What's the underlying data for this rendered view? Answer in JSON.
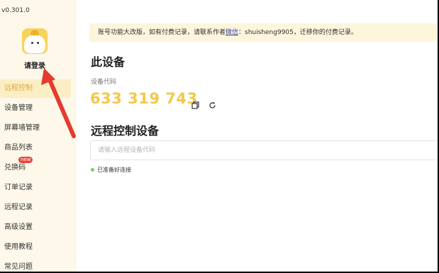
{
  "app": {
    "version": "v0.301.0"
  },
  "sidebar": {
    "login_label": "请登录",
    "items": [
      {
        "label": "远程控制",
        "active": true
      },
      {
        "label": "设备管理"
      },
      {
        "label": "屏幕墙管理"
      },
      {
        "label": "商品列表"
      },
      {
        "label": "兑换码",
        "badge": "new"
      },
      {
        "label": "订单记录"
      },
      {
        "label": "远程记录"
      },
      {
        "label": "高级设置"
      },
      {
        "label": "使用教程"
      },
      {
        "label": "常见问题"
      }
    ]
  },
  "notice": {
    "prefix": "账号功能大改版，如有付费记录，请联系作者",
    "link": "微信",
    "suffix": "：shuisheng9905，迁移你的付费记录。"
  },
  "device": {
    "heading": "此设备",
    "code_label": "设备代码",
    "code": "633 319 743"
  },
  "remote": {
    "heading": "远程控制设备",
    "input_placeholder": "请输入远程设备代码",
    "input_value": "",
    "status": "已准备好连接"
  },
  "colors": {
    "accent": "#f2c94c",
    "sidebar_bg": "#fdf8ea",
    "active_item_bg": "#fbeec5",
    "arrow": "#e53a2f",
    "status_ok": "#7ac96b"
  },
  "icons": [
    "copy-icon",
    "refresh-icon",
    "avatar"
  ]
}
